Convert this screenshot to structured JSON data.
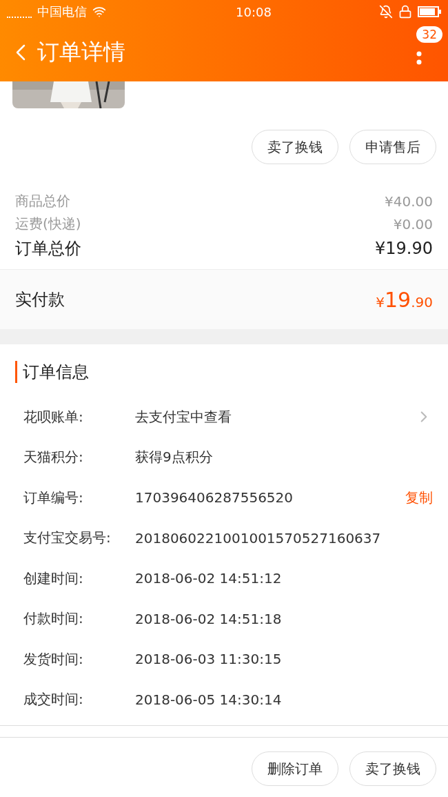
{
  "status_bar": {
    "carrier": "中国电信",
    "time": "10:08"
  },
  "header": {
    "title": "订单详情",
    "badge": "32"
  },
  "actions": [
    {
      "label": "卖了换钱"
    },
    {
      "label": "申请售后"
    }
  ],
  "prices": [
    {
      "kind": "minor",
      "label": "商品总价",
      "value": "¥40.00"
    },
    {
      "kind": "minor",
      "label": "运费(快递)",
      "value": "¥0.00"
    },
    {
      "kind": "major",
      "label": "订单总价",
      "value": "¥19.90"
    }
  ],
  "paid": {
    "label": "实付款",
    "currency": "¥",
    "integer": "19",
    "decimal": ".90"
  },
  "order_info": {
    "title": "订单信息",
    "rows": [
      {
        "label": "花呗账单:",
        "value": "去支付宝中查看",
        "kind": "link"
      },
      {
        "label": "天猫积分:",
        "value": "获得9点积分",
        "kind": "plain"
      },
      {
        "label": "订单编号:",
        "value": "170396406287556520",
        "kind": "copy",
        "action": "复制"
      },
      {
        "label": "支付宝交易号:",
        "value": "2018060221001001570527160637",
        "kind": "plain"
      },
      {
        "label": "创建时间:",
        "value": "2018-06-02 14:51:12",
        "kind": "plain"
      },
      {
        "label": "付款时间:",
        "value": "2018-06-02 14:51:18",
        "kind": "plain"
      },
      {
        "label": "发货时间:",
        "value": "2018-06-03 11:30:15",
        "kind": "plain"
      },
      {
        "label": "成交时间:",
        "value": "2018-06-05 14:30:14",
        "kind": "plain"
      }
    ]
  },
  "bottom_actions": [
    {
      "label": "删除订单"
    },
    {
      "label": "卖了换钱"
    }
  ]
}
